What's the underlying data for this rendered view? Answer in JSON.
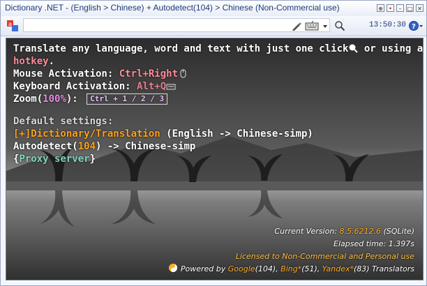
{
  "window": {
    "title": "Dictionary .NET - (English > Chinese) + Autodetect(104) > Chinese (Non-Commercial use)",
    "controls": [
      "⊕",
      "•",
      "–",
      "□",
      "✕"
    ]
  },
  "toolbar": {
    "search_value": "",
    "time": "13:50:30",
    "icons": [
      "app-logo-icon",
      "pen-icon",
      "keyboard-icon",
      "dropdown-arrow-icon",
      "search-icon",
      "help-icon"
    ]
  },
  "main": {
    "intro_prefix": "Translate any language, word and text with just one click",
    "intro_suffix": " or using a",
    "hotkey": "hotkey",
    "period": ".",
    "mouse_label": "Mouse Activation: ",
    "mouse_value": "Ctrl+Right",
    "keyboard_label": "Keyboard Activation: ",
    "keyboard_value": "Alt+Q",
    "zoom_label": "Zoom(",
    "zoom_value": "100%",
    "zoom_close": "):",
    "zoom_options": "Ctrl + 1 / 2 / 3",
    "default_settings": "Default settings:",
    "dictionary_link": "[+]Dictionary/Translation",
    "dictionary_pair": " (English -> Chinese-simp)",
    "autodetect_label": "Autodetect(",
    "autodetect_count": "104",
    "autodetect_suffix": ") -> Chinese-simp",
    "proxy_open": "{",
    "proxy_link": "Proxy server",
    "proxy_close": "}"
  },
  "footer": {
    "version_label": "Current Version: ",
    "version": "8.5.6212.6",
    "version_suffix": " (SQLite)",
    "elapsed": "Elapsed time: 1.397s",
    "license": "Licensed to Non-Commercial and Personal use",
    "powered_by": "Powered by ",
    "google": "Google",
    "google_count": "(104), ",
    "bing": "Bing*",
    "bing_count": "(51), ",
    "yandex": "Yandex*",
    "yandex_count": "(83) Translators"
  },
  "colors": {
    "hotkey": "#ff8c9a",
    "magenta": "#e58de6",
    "orange": "#ffa21a",
    "proxy": "#7fd7c0"
  }
}
